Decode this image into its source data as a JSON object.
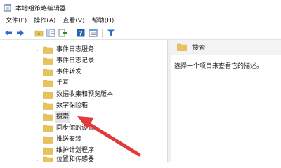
{
  "window": {
    "title": "本地组策略编辑器"
  },
  "menu": [
    {
      "label": "文件(F)"
    },
    {
      "label": "操作(A)"
    },
    {
      "label": "查看(V)"
    },
    {
      "label": "帮助(H)"
    }
  ],
  "toolbar": {
    "buttons": [
      {
        "icon": "back-arrow-icon"
      },
      {
        "icon": "forward-arrow-icon"
      },
      {
        "icon": "up-folder-icon"
      },
      {
        "icon": "show-hide-tree-icon"
      },
      {
        "icon": "export-list-icon"
      },
      {
        "icon": "help-icon"
      },
      {
        "icon": "properties-icon"
      },
      {
        "icon": "filter-icon"
      }
    ]
  },
  "tree": {
    "items": [
      {
        "label": "事件日志服务",
        "expandable": true,
        "selected": false
      },
      {
        "label": "事件日志记录",
        "expandable": false,
        "selected": false
      },
      {
        "label": "事件转发",
        "expandable": false,
        "selected": false
      },
      {
        "label": "手写",
        "expandable": false,
        "selected": false
      },
      {
        "label": "数据收集和预览版本",
        "expandable": false,
        "selected": false
      },
      {
        "label": "数字保险箱",
        "expandable": false,
        "selected": false
      },
      {
        "label": "搜索",
        "expandable": false,
        "selected": true
      },
      {
        "label": "同步你的设置",
        "expandable": false,
        "selected": false
      },
      {
        "label": "推送安装",
        "expandable": false,
        "selected": false
      },
      {
        "label": "维护计划程序",
        "expandable": false,
        "selected": false
      },
      {
        "label": "位置和传感器",
        "expandable": true,
        "selected": false
      }
    ]
  },
  "details": {
    "header_title": "搜索",
    "description": "选择一个项目来查看它的描述。"
  },
  "colors": {
    "folder": "#e8c25a",
    "folder_dark": "#d4a93c",
    "annotation_arrow": "#e03a3a",
    "selection": "#e5e5e5"
  }
}
